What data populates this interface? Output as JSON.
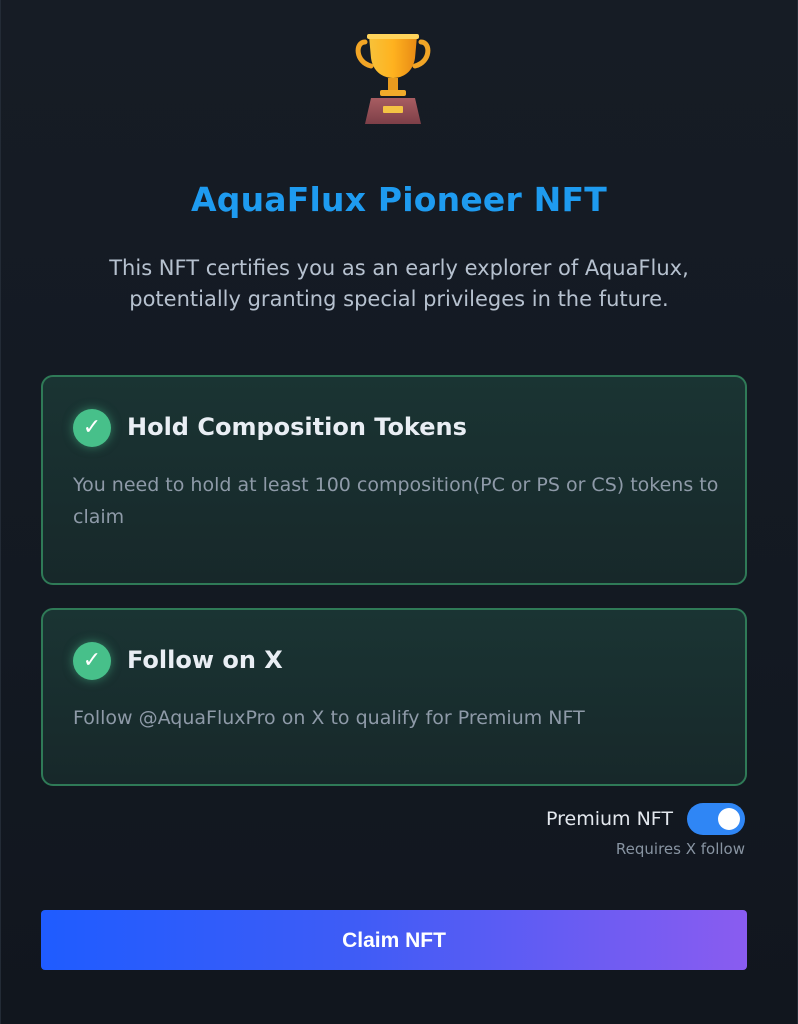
{
  "header": {
    "icon": "trophy-icon",
    "title": "AquaFlux Pioneer NFT",
    "subtitle": "This NFT certifies you as an early explorer of AquaFlux, potentially granting special privileges in the future."
  },
  "requirements": [
    {
      "icon": "check-circle-icon",
      "title": "Hold Composition Tokens",
      "description": "You need to hold at least 100 composition(PC or PS or CS) tokens to claim"
    },
    {
      "icon": "check-circle-icon",
      "title": "Follow on X",
      "description": "Follow @AquaFluxPro on X to qualify for Premium NFT"
    }
  ],
  "premium": {
    "label": "Premium NFT",
    "enabled": true,
    "note": "Requires X follow"
  },
  "actions": {
    "claim_label": "Claim NFT"
  },
  "colors": {
    "title": "#1e9bf0",
    "success": "#47c08a",
    "toggle_on": "#2f86f5",
    "button_gradient_start": "#1f5cff",
    "button_gradient_end": "#8a5cf0"
  }
}
